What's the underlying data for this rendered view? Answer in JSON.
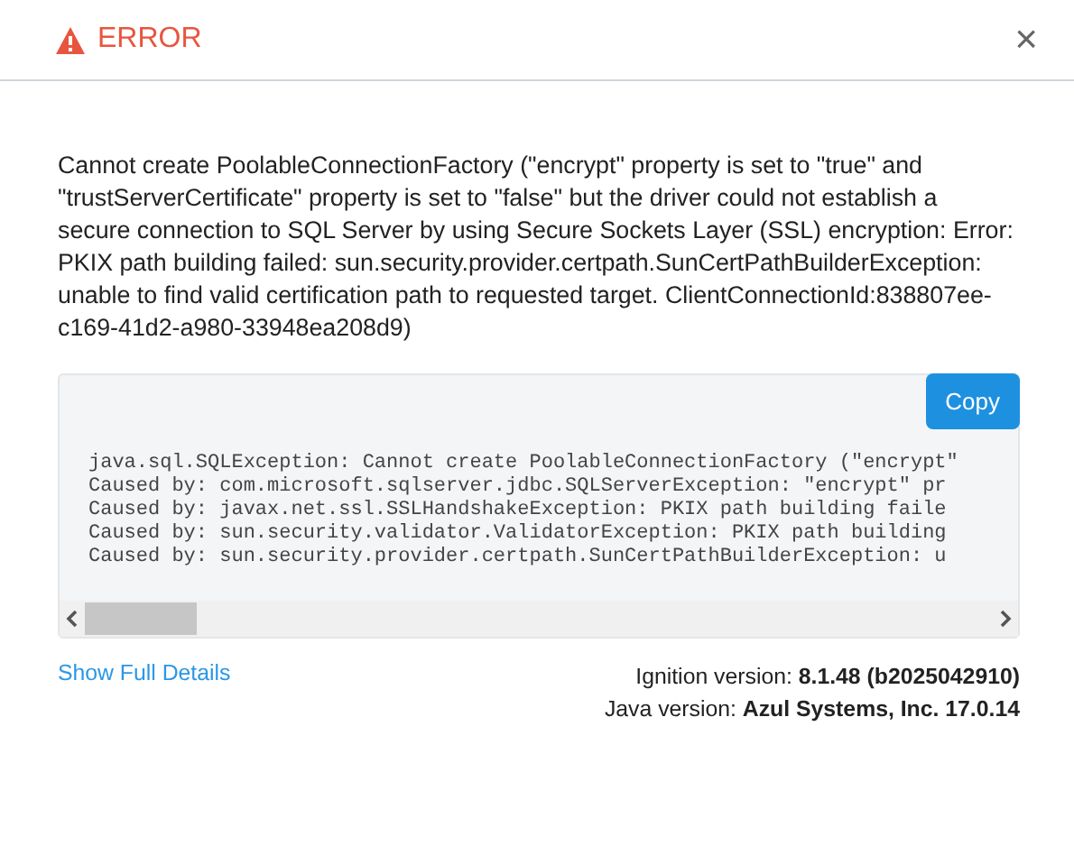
{
  "dialog": {
    "title": "ERROR",
    "close": "×"
  },
  "message": "Cannot create PoolableConnectionFactory (\"encrypt\" property is set to \"true\" and \"trustServerCertificate\" property is set to \"false\" but the driver could not establish a secure connection to SQL Server by using Secure Sockets Layer (SSL) encryption: Error: PKIX path building failed: sun.security.provider.certpath.SunCertPathBuilderException: unable to find valid certification path to requested target. ClientConnectionId:838807ee-c169-41d2-a980-33948ea208d9)",
  "details": {
    "copy_button": "Copy",
    "lines": [
      "java.sql.SQLException: Cannot create PoolableConnectionFactory (\"encrypt\"",
      "Caused by: com.microsoft.sqlserver.jdbc.SQLServerException: \"encrypt\" pr",
      "Caused by: javax.net.ssl.SSLHandshakeException: PKIX path building faile",
      "Caused by: sun.security.validator.ValidatorException: PKIX path building",
      "Caused by: sun.security.provider.certpath.SunCertPathBuilderException: u"
    ]
  },
  "footer": {
    "link": "Show Full Details",
    "versions": [
      "Ignition version: **8.1.48 (b2025042910)**",
      "Java version: **Azul Systems, Inc. 17.0.14**"
    ]
  }
}
